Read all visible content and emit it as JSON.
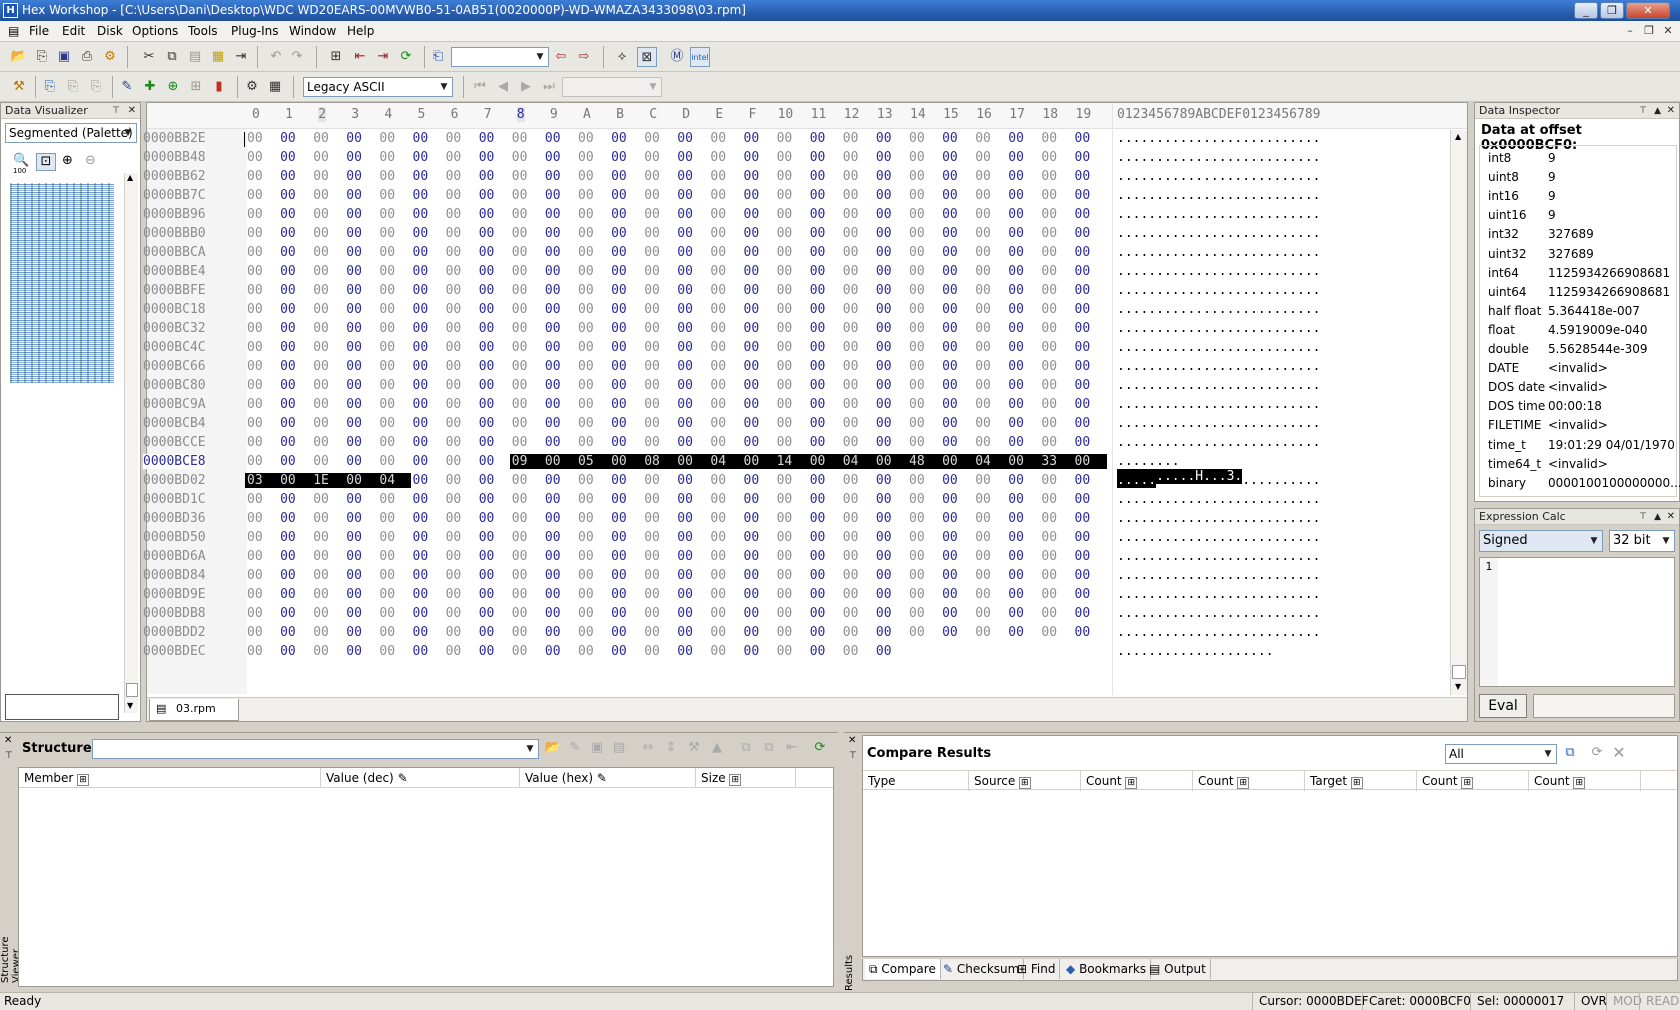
{
  "window": {
    "title": "Hex Workshop - [C:\\Users\\Dani\\Desktop\\WDC WD20EARS-00MVWB0-51-0AB51(0020000P)-WD-WMAZA3433098\\03.rpm]",
    "controls": [
      "_",
      "❐",
      "✕"
    ]
  },
  "menu": {
    "items": [
      "File",
      "Edit",
      "Disk",
      "Options",
      "Tools",
      "Plug-Ins",
      "Window",
      "Help"
    ],
    "mdi_controls": [
      "–",
      "❐",
      "✕"
    ]
  },
  "toolbar2": {
    "encoding": "Legacy ASCII"
  },
  "data_visualizer": {
    "title": "Data Visualizer",
    "mode": "Segmented (Palette)",
    "zoom_label": "100"
  },
  "hex_editor": {
    "column_headers": [
      "0",
      "1",
      "2",
      "3",
      "4",
      "5",
      "6",
      "7",
      "8",
      "9",
      "A",
      "B",
      "C",
      "D",
      "E",
      "F",
      "10",
      "11",
      "12",
      "13",
      "14",
      "15",
      "16",
      "17",
      "18",
      "19"
    ],
    "ascii_header": "0123456789ABCDEF0123456789",
    "offsets": [
      "0000BB2E",
      "0000BB48",
      "0000BB62",
      "0000BB7C",
      "0000BB96",
      "0000BBB0",
      "0000BBCA",
      "0000BBE4",
      "0000BBFE",
      "0000BC18",
      "0000BC32",
      "0000BC4C",
      "0000BC66",
      "0000BC80",
      "0000BC9A",
      "0000BCB4",
      "0000BCCE",
      "0000BCE8",
      "0000BD02",
      "0000BD1C",
      "0000BD36",
      "0000BD50",
      "0000BD6A",
      "0000BD84",
      "0000BD9E",
      "0000BDB8",
      "0000BDD2",
      "0000BDEC"
    ],
    "row_bce8_bytes": [
      "00",
      "00",
      "00",
      "00",
      "00",
      "00",
      "00",
      "00",
      "09",
      "00",
      "05",
      "00",
      "08",
      "00",
      "04",
      "00",
      "14",
      "00",
      "04",
      "00",
      "48",
      "00",
      "04",
      "00",
      "33",
      "00"
    ],
    "row_bce8_ascii": "........ ..........H...3.",
    "row_bd02_bytes": [
      "03",
      "00",
      "1E",
      "00",
      "04"
    ],
    "row_bd02_ascii": ".....",
    "last_row_count": 20,
    "file_tab": "03.rpm"
  },
  "data_inspector": {
    "title": "Data Inspector",
    "heading": "Data at offset 0x0000BCF0:",
    "rows": [
      {
        "label": "int8",
        "value": "9"
      },
      {
        "label": "uint8",
        "value": "9"
      },
      {
        "label": "int16",
        "value": "9"
      },
      {
        "label": "uint16",
        "value": "9"
      },
      {
        "label": "int32",
        "value": "327689"
      },
      {
        "label": "uint32",
        "value": "327689"
      },
      {
        "label": "int64",
        "value": "1125934266908681"
      },
      {
        "label": "uint64",
        "value": "1125934266908681"
      },
      {
        "label": "half float",
        "value": "5.364418e-007"
      },
      {
        "label": "float",
        "value": "4.5919009e-040"
      },
      {
        "label": "double",
        "value": "5.5628544e-309"
      },
      {
        "label": "DATE",
        "value": "<invalid>"
      },
      {
        "label": "DOS date",
        "value": "<invalid>"
      },
      {
        "label": "DOS time",
        "value": "00:00:18"
      },
      {
        "label": "FILETIME",
        "value": "<invalid>"
      },
      {
        "label": "time_t",
        "value": "19:01:29 04/01/1970"
      },
      {
        "label": "time64_t",
        "value": "<invalid>"
      },
      {
        "label": "binary",
        "value": "0000100100000000..."
      }
    ]
  },
  "expression_calc": {
    "title": "Expression Calc",
    "sign_mode": "Signed",
    "bit_width": "32 bit",
    "line_number": "1",
    "eval_label": "Eval"
  },
  "structures": {
    "title": "Structures",
    "side_label": "Structure Viewer",
    "columns": [
      "Member",
      "Value (dec)",
      "Value (hex)",
      "Size"
    ]
  },
  "compare": {
    "title": "Compare Results",
    "filter": "All",
    "side_label": "Results",
    "columns": [
      "Type",
      "Source",
      "Count",
      "Count",
      "Target",
      "Count",
      "Count"
    ],
    "tabs": [
      "Compare",
      "Checksum",
      "Find",
      "Bookmarks",
      "Output"
    ]
  },
  "status": {
    "ready": "Ready",
    "cursor": "Cursor: 0000BDEF",
    "caret": "Caret: 0000BCF0",
    "sel": "Sel: 00000017",
    "ovr": "OVR",
    "mod": "MOD",
    "read": "READ"
  },
  "colors": {
    "title_bar": "#2a5fb0",
    "selection_bg": "#000000",
    "zero_byte_dark": "#2b2b9a",
    "zero_byte_light": "#8f8f8f",
    "offset_text": "#8c8c8c"
  }
}
